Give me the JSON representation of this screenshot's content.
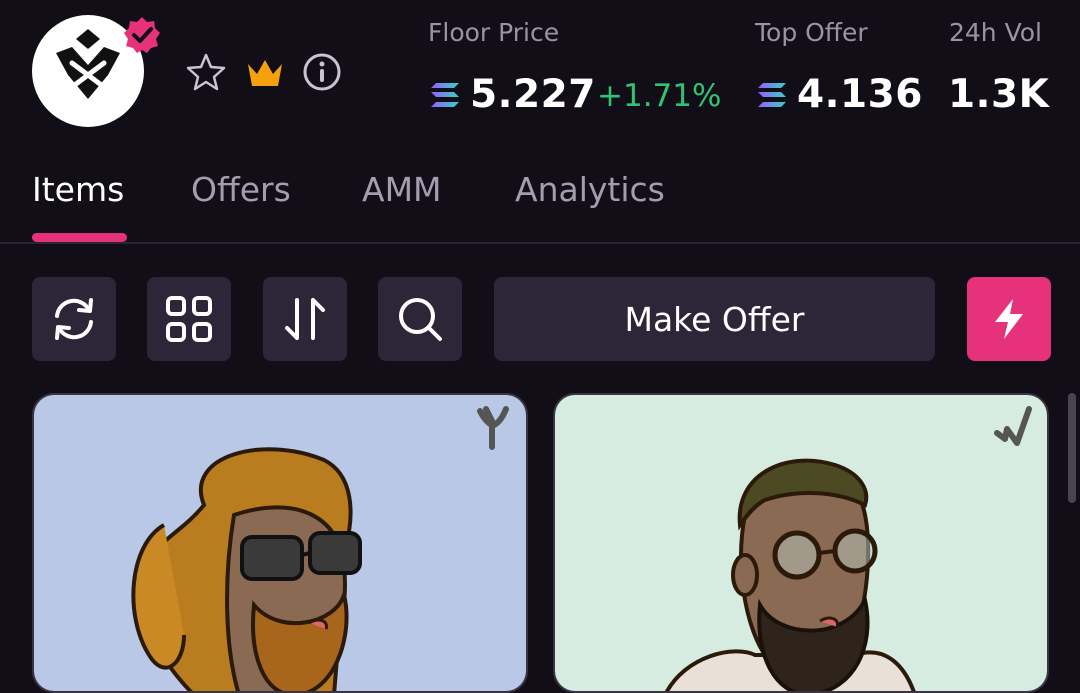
{
  "header": {
    "stats": [
      {
        "label": "Floor Price",
        "value": "5.227",
        "change": "+1.71%"
      },
      {
        "label": "Top Offer",
        "value": "4.136"
      },
      {
        "label": "24h Vol",
        "value": "1.3K"
      }
    ],
    "icons": [
      "verified-badge-icon",
      "star-icon",
      "crown-icon",
      "info-icon"
    ]
  },
  "tabs": [
    {
      "label": "Items",
      "active": true
    },
    {
      "label": "Offers",
      "active": false
    },
    {
      "label": "AMM",
      "active": false
    },
    {
      "label": "Analytics",
      "active": false
    }
  ],
  "toolbar": {
    "icons": [
      "refresh-icon",
      "grid-icon",
      "sort-icon",
      "search-icon",
      "lightning-icon"
    ],
    "make_offer_label": "Make Offer"
  },
  "cards": [
    {
      "background": "#b9c8e6",
      "trait_icon": "rune-y-icon"
    },
    {
      "background": "#d6ece1",
      "trait_icon": "rune-j-icon"
    }
  ],
  "colors": {
    "background": "#120e17",
    "accent": "#e5327a",
    "positive": "#2fc373",
    "button": "#2d2538",
    "muted_text": "#a39db0"
  }
}
